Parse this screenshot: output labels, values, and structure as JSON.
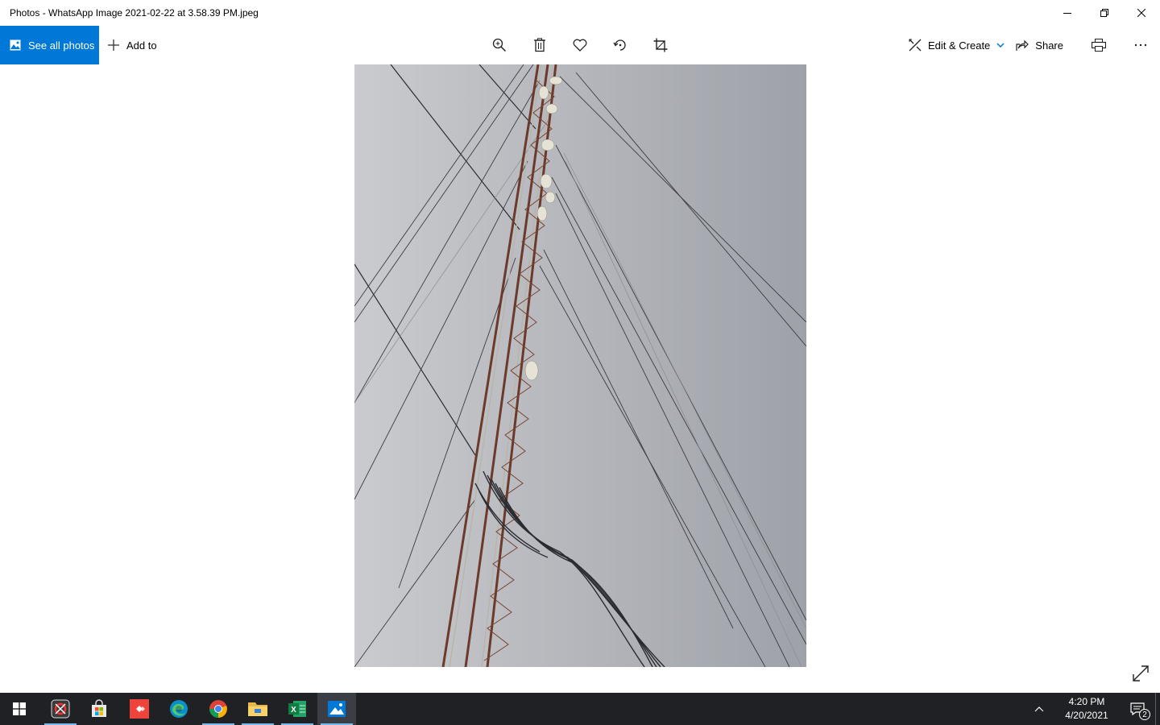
{
  "window": {
    "title": "Photos - WhatsApp Image 2021-02-22 at 3.58.39 PM.jpeg",
    "minimize_icon": "minimize-icon",
    "restore_icon": "restore-icon",
    "close_icon": "close-icon"
  },
  "toolbar": {
    "see_all_label": "See all photos",
    "add_to_label": "Add to",
    "edit_create_label": "Edit & Create",
    "share_label": "Share",
    "center_icons": [
      "zoom-icon",
      "delete-icon",
      "favorite-icon",
      "rotate-icon",
      "crop-icon"
    ],
    "accent_color": "#0078d7"
  },
  "photo": {
    "subject": "lattice tower with guy wires and cables against overcast sky"
  },
  "taskbar": {
    "apps": [
      "start",
      "snipping-tool",
      "microsoft-store",
      "anydesk",
      "edge",
      "chrome",
      "file-explorer",
      "excel",
      "photos"
    ],
    "time": "4:20 PM",
    "date": "4/20/2021",
    "notification_count": "2"
  }
}
